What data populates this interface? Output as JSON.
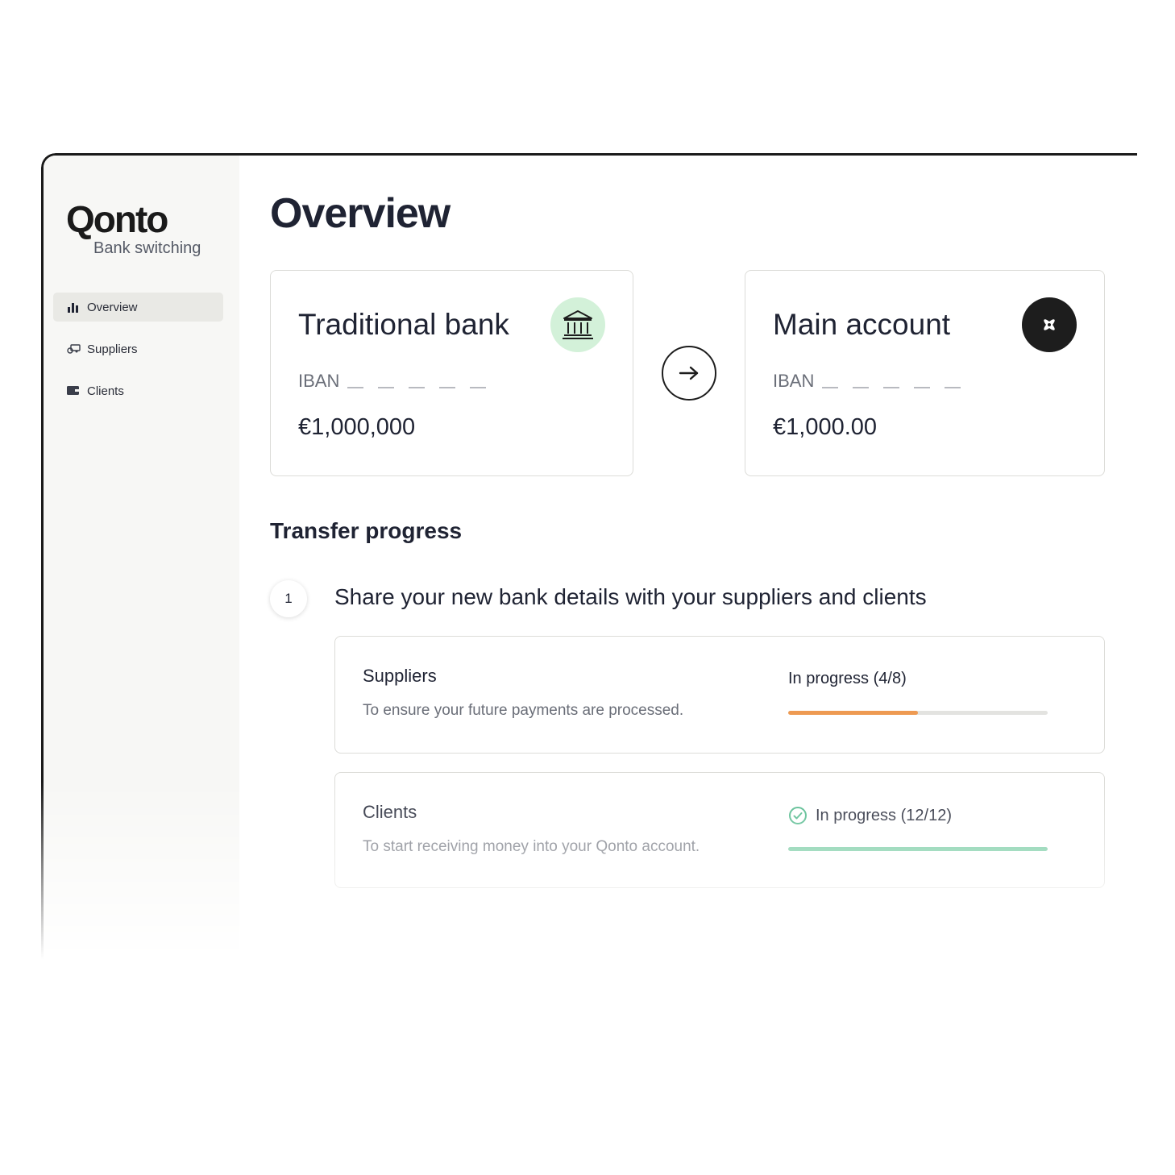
{
  "sidebar": {
    "logo": "Qonto",
    "subtitle": "Bank switching",
    "items": [
      {
        "label": "Overview",
        "icon": "bar-chart-icon",
        "active": true
      },
      {
        "label": "Suppliers",
        "icon": "truck-icon",
        "active": false
      },
      {
        "label": "Clients",
        "icon": "wallet-icon",
        "active": false
      }
    ]
  },
  "main": {
    "title": "Overview",
    "source_card": {
      "title": "Traditional bank",
      "iban_label": "IBAN",
      "amount": "€1,000,000",
      "icon": "bank-icon",
      "badge_color": "#d3f1d9"
    },
    "target_card": {
      "title": "Main account",
      "iban_label": "IBAN",
      "amount": "€1,000.00",
      "icon": "qonto-flower-icon",
      "badge_color": "#1d1d1d"
    },
    "transfer_icon": "arrow-right-icon",
    "section_title": "Transfer progress",
    "step": {
      "number": "1",
      "title": "Share your new bank details with your suppliers and clients",
      "tasks": [
        {
          "title": "Suppliers",
          "description": "To ensure your future payments are processed.",
          "status": "In progress (4/8)",
          "progress": 0.5,
          "color": "#ee9a52",
          "complete": false
        },
        {
          "title": "Clients",
          "description": "To start receiving money into your Qonto account.",
          "status": "In progress (12/12)",
          "progress": 1.0,
          "color": "#6cc79b",
          "complete": true
        }
      ]
    }
  }
}
